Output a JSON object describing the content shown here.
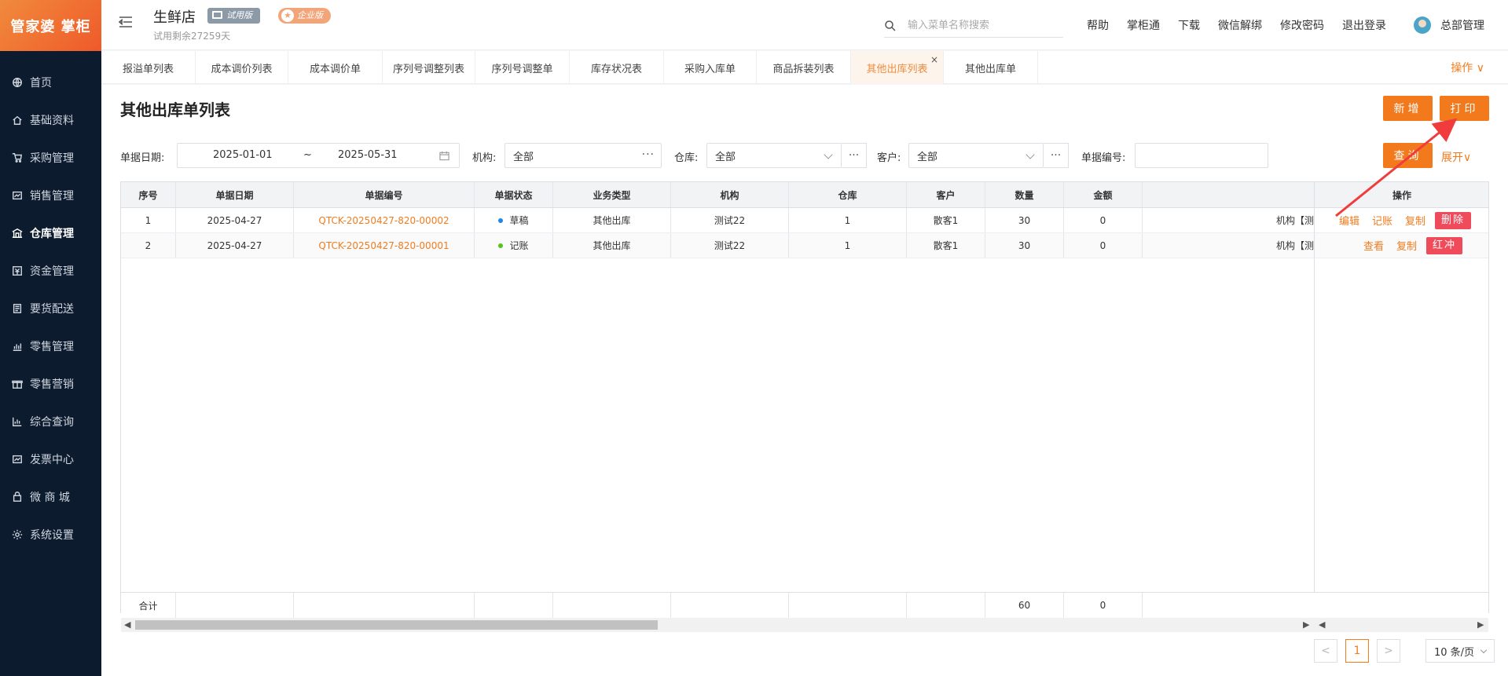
{
  "sidebar": {
    "logo": "管家婆 掌柜",
    "items": [
      {
        "label": "首页",
        "icon": "globe-icon"
      },
      {
        "label": "基础资料",
        "icon": "home-icon"
      },
      {
        "label": "采购管理",
        "icon": "cart-icon"
      },
      {
        "label": "销售管理",
        "icon": "sales-icon"
      },
      {
        "label": "仓库管理",
        "icon": "warehouse-icon"
      },
      {
        "label": "资金管理",
        "icon": "money-icon"
      },
      {
        "label": "要货配送",
        "icon": "delivery-icon"
      },
      {
        "label": "零售管理",
        "icon": "retail-icon"
      },
      {
        "label": "零售营销",
        "icon": "gift-icon"
      },
      {
        "label": "综合查询",
        "icon": "chart-icon"
      },
      {
        "label": "发票中心",
        "icon": "invoice-icon"
      },
      {
        "label": "微 商 城",
        "icon": "shop-icon"
      },
      {
        "label": "系统设置",
        "icon": "gear-icon"
      }
    ]
  },
  "header": {
    "store_name": "生鲜店",
    "badge_trial": "试用版",
    "badge_enterprise": "企业版",
    "trial_days": "试用剩余27259天",
    "search_placeholder": "输入菜单名称搜索",
    "links": [
      "帮助",
      "掌柜通",
      "下载",
      "微信解绑",
      "修改密码",
      "退出登录"
    ],
    "user_name": "总部管理"
  },
  "tabs": {
    "items": [
      "报溢单列表",
      "成本调价列表",
      "成本调价单",
      "序列号调整列表",
      "序列号调整单",
      "库存状况表",
      "采购入库单",
      "商品拆装列表",
      "其他出库列表",
      "其他出库单"
    ],
    "close_symbol": "×",
    "ops_label": "操作 ∨"
  },
  "page": {
    "title": "其他出库单列表",
    "btn_new": "新增",
    "btn_print": "打印",
    "btn_query": "查询",
    "expand_label": "展开∨"
  },
  "filters": {
    "date_label": "单据日期:",
    "date_start": "2025-01-01",
    "date_sep": "~",
    "date_end": "2025-05-31",
    "org_label": "机构:",
    "org_value": "全部",
    "warehouse_label": "仓库:",
    "warehouse_value": "全部",
    "customer_label": "客户:",
    "customer_value": "全部",
    "bill_no_label": "单据编号:",
    "bill_no_value": ""
  },
  "table": {
    "headers": [
      "序号",
      "单据日期",
      "单据编号",
      "单据状态",
      "业务类型",
      "机构",
      "仓库",
      "客户",
      "数量",
      "金额",
      "",
      "操作"
    ],
    "rows": [
      {
        "no": "1",
        "date": "2025-04-27",
        "bill_no": "QTCK-20250427-820-00002",
        "status": "草稿",
        "status_color": "#1e88e5",
        "biz_type": "其他出库",
        "org": "测试22",
        "warehouse": "1",
        "customer": "散客1",
        "qty": "30",
        "amount": "0",
        "extra": "机构【测",
        "ops": [
          "编辑",
          "记账",
          "复制"
        ],
        "op_red": "删除"
      },
      {
        "no": "2",
        "date": "2025-04-27",
        "bill_no": "QTCK-20250427-820-00001",
        "status": "记账",
        "status_color": "#52c41a",
        "biz_type": "其他出库",
        "org": "测试22",
        "warehouse": "1",
        "customer": "散客1",
        "qty": "30",
        "amount": "0",
        "extra": "机构【测",
        "ops": [
          "查看",
          "复制"
        ],
        "op_red": "红冲"
      }
    ],
    "footer": {
      "label": "合计",
      "qty": "60",
      "amount": "0"
    }
  },
  "pagination": {
    "prev": "<",
    "current": "1",
    "next": ">",
    "page_size": "10 条/页"
  },
  "colors": {
    "accent": "#f27a1d",
    "sidebar_bg": "#0c1b2e",
    "danger": "#f04b5a",
    "annotation_arrow": "#f03c3c"
  }
}
